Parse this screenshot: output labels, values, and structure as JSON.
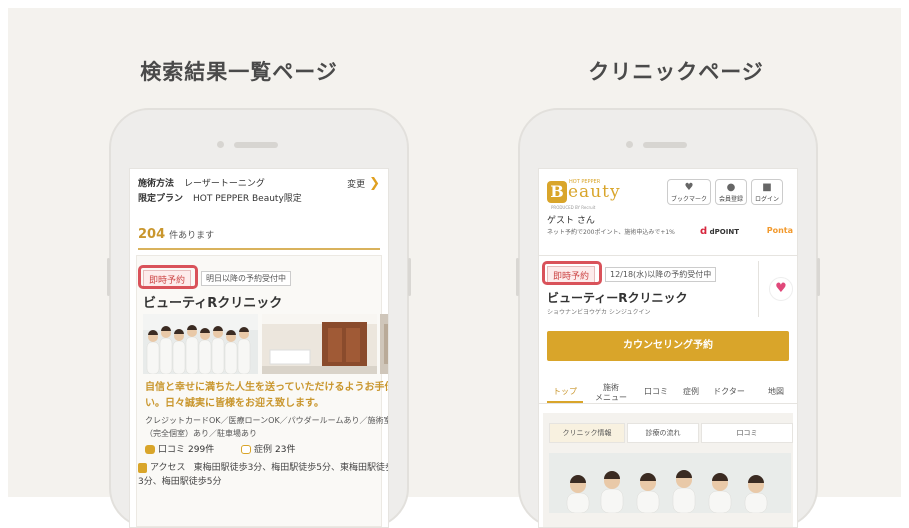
{
  "left": {
    "title": "検索結果一覧ページ",
    "filter": {
      "method_label": "施術方法",
      "method_value": "レーザートーニング",
      "change_label": "変更",
      "plan_label": "限定プラン",
      "plan_value": "HOT PEPPER Beauty限定"
    },
    "result_count": "204",
    "result_suffix": "件あります",
    "card": {
      "tag_instant": "即時予約",
      "tag_next": "明日以降の予約受付中",
      "clinic_name": "ビューティRクリニック",
      "catch_copy": "自信と幸せに満ちた人生を送っていただけるようお手伝い。日々誠実に皆様をお迎え致します。",
      "features": "クレジットカードOK／医療ローンOK／パウダールームあり／施術室（完全個室）あり／駐車場あり",
      "reviews_label": "口コミ",
      "reviews_count": "299件",
      "cases_label": "症例",
      "cases_count": "23件",
      "access_label": "アクセス",
      "access_text": "東梅田駅徒歩3分、梅田駅徒歩5分、東梅田駅徒歩3分、梅田駅徒歩5分"
    }
  },
  "right": {
    "title": "クリニックページ",
    "logo": {
      "small": "HOT PEPPER",
      "text": "eauty",
      "sub": "PRODUCED BY Recruit"
    },
    "header_buttons": {
      "bookmark": "ブックマーク",
      "register": "会員登録",
      "login": "ログイン"
    },
    "guest": "ゲスト さん",
    "guest_sub": "ネット予約で200ポイント、施術申込みで+1%",
    "dpoint": "dPOINT",
    "ponta": "Ponta",
    "tag_instant": "即時予約",
    "tag_next": "12/18(水)以降の予約受付中",
    "clinic_name": "ビューティーRクリニック",
    "clinic_kana": "ショウナンビヨウゲカ シンジュクイン",
    "counsel_button": "カウンセリング予約",
    "tabs": {
      "top": "トップ",
      "menu_line1": "施術",
      "menu_line2": "メニュー",
      "reviews": "口コミ",
      "cases": "症例",
      "doctors": "ドクター",
      "map": "地図"
    },
    "subtabs": {
      "info": "クリニック情報",
      "flow": "診療の流れ",
      "reviews": "口コミ"
    }
  },
  "colors": {
    "accent": "#d9a52a",
    "highlight": "#d9525a",
    "panel_bg": "#f4f2ee"
  }
}
